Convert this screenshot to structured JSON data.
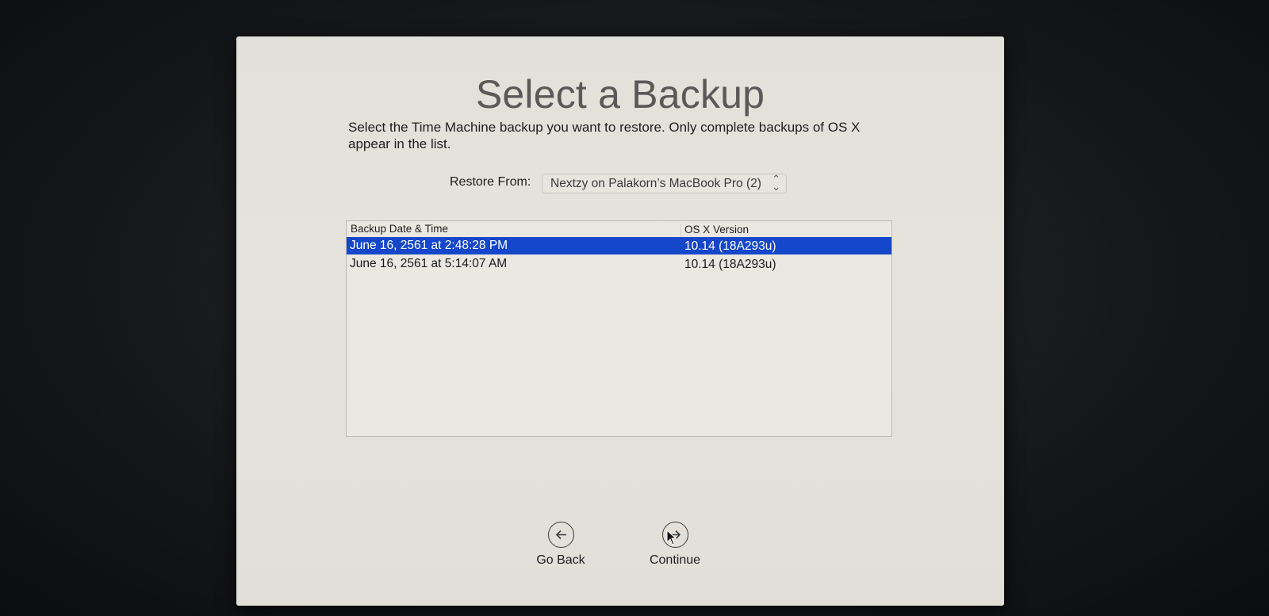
{
  "dialog": {
    "title": "Select a Backup",
    "description": "Select the Time Machine backup you want to restore. Only complete backups of OS X appear in the list.",
    "restore_from": {
      "label": "Restore From:",
      "selected_value": "Nextzy on Palakorn’s MacBook Pro (2)",
      "chevron": "⌃⌄"
    },
    "table": {
      "columns": [
        "Backup Date & Time",
        "OS X Version"
      ],
      "rows": [
        {
          "date": "June 16, 2561 at 2:48:28 PM",
          "version": "10.14 (18A293u)",
          "selected": true
        },
        {
          "date": "June 16, 2561 at 5:14:07 AM",
          "version": "10.14 (18A293u)",
          "selected": false
        }
      ]
    },
    "buttons": {
      "back_label": "Go Back",
      "back_icon": "arrow-left-circle-icon",
      "continue_label": "Continue",
      "continue_icon": "arrow-right-circle-icon"
    }
  },
  "colors": {
    "selection": "#1447c9",
    "window_bg": "#e3e0d9",
    "title_text": "#5a5958"
  }
}
